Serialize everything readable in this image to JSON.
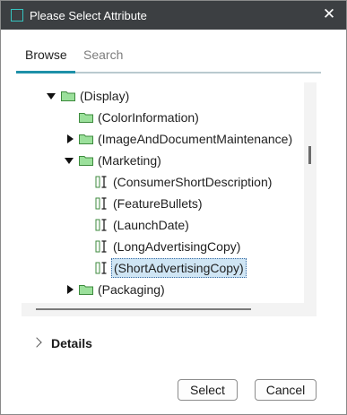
{
  "window": {
    "title": "Please Select Attribute",
    "close_glyph": "✕"
  },
  "tabs": [
    {
      "label": "Browse",
      "active": true
    },
    {
      "label": "Search",
      "active": false
    }
  ],
  "tree": {
    "rows": [
      {
        "label": "(Display)",
        "kind": "folder",
        "expander": "expanded"
      },
      {
        "label": "(ColorInformation)",
        "kind": "folder",
        "expander": "none"
      },
      {
        "label": "(ImageAndDocumentMaintenance)",
        "kind": "folder",
        "expander": "collapsed"
      },
      {
        "label": "(Marketing)",
        "kind": "folder",
        "expander": "expanded"
      },
      {
        "label": "(ConsumerShortDescription)",
        "kind": "attribute",
        "expander": "none"
      },
      {
        "label": "(FeatureBullets)",
        "kind": "attribute",
        "expander": "none"
      },
      {
        "label": "(LaunchDate)",
        "kind": "attribute",
        "expander": "none"
      },
      {
        "label": "(LongAdvertisingCopy)",
        "kind": "attribute",
        "expander": "none"
      },
      {
        "label": "(ShortAdvertisingCopy)",
        "kind": "attribute",
        "expander": "none",
        "selected": true
      },
      {
        "label": "(Packaging)",
        "kind": "folder",
        "expander": "collapsed"
      }
    ]
  },
  "details": {
    "label": "Details"
  },
  "buttons": {
    "select": "Select",
    "cancel": "Cancel"
  },
  "colors": {
    "titlebar": "#3c3f42",
    "accent": "#1e90a8",
    "folder": "#9be09b",
    "selection": "#cfe5f4"
  }
}
